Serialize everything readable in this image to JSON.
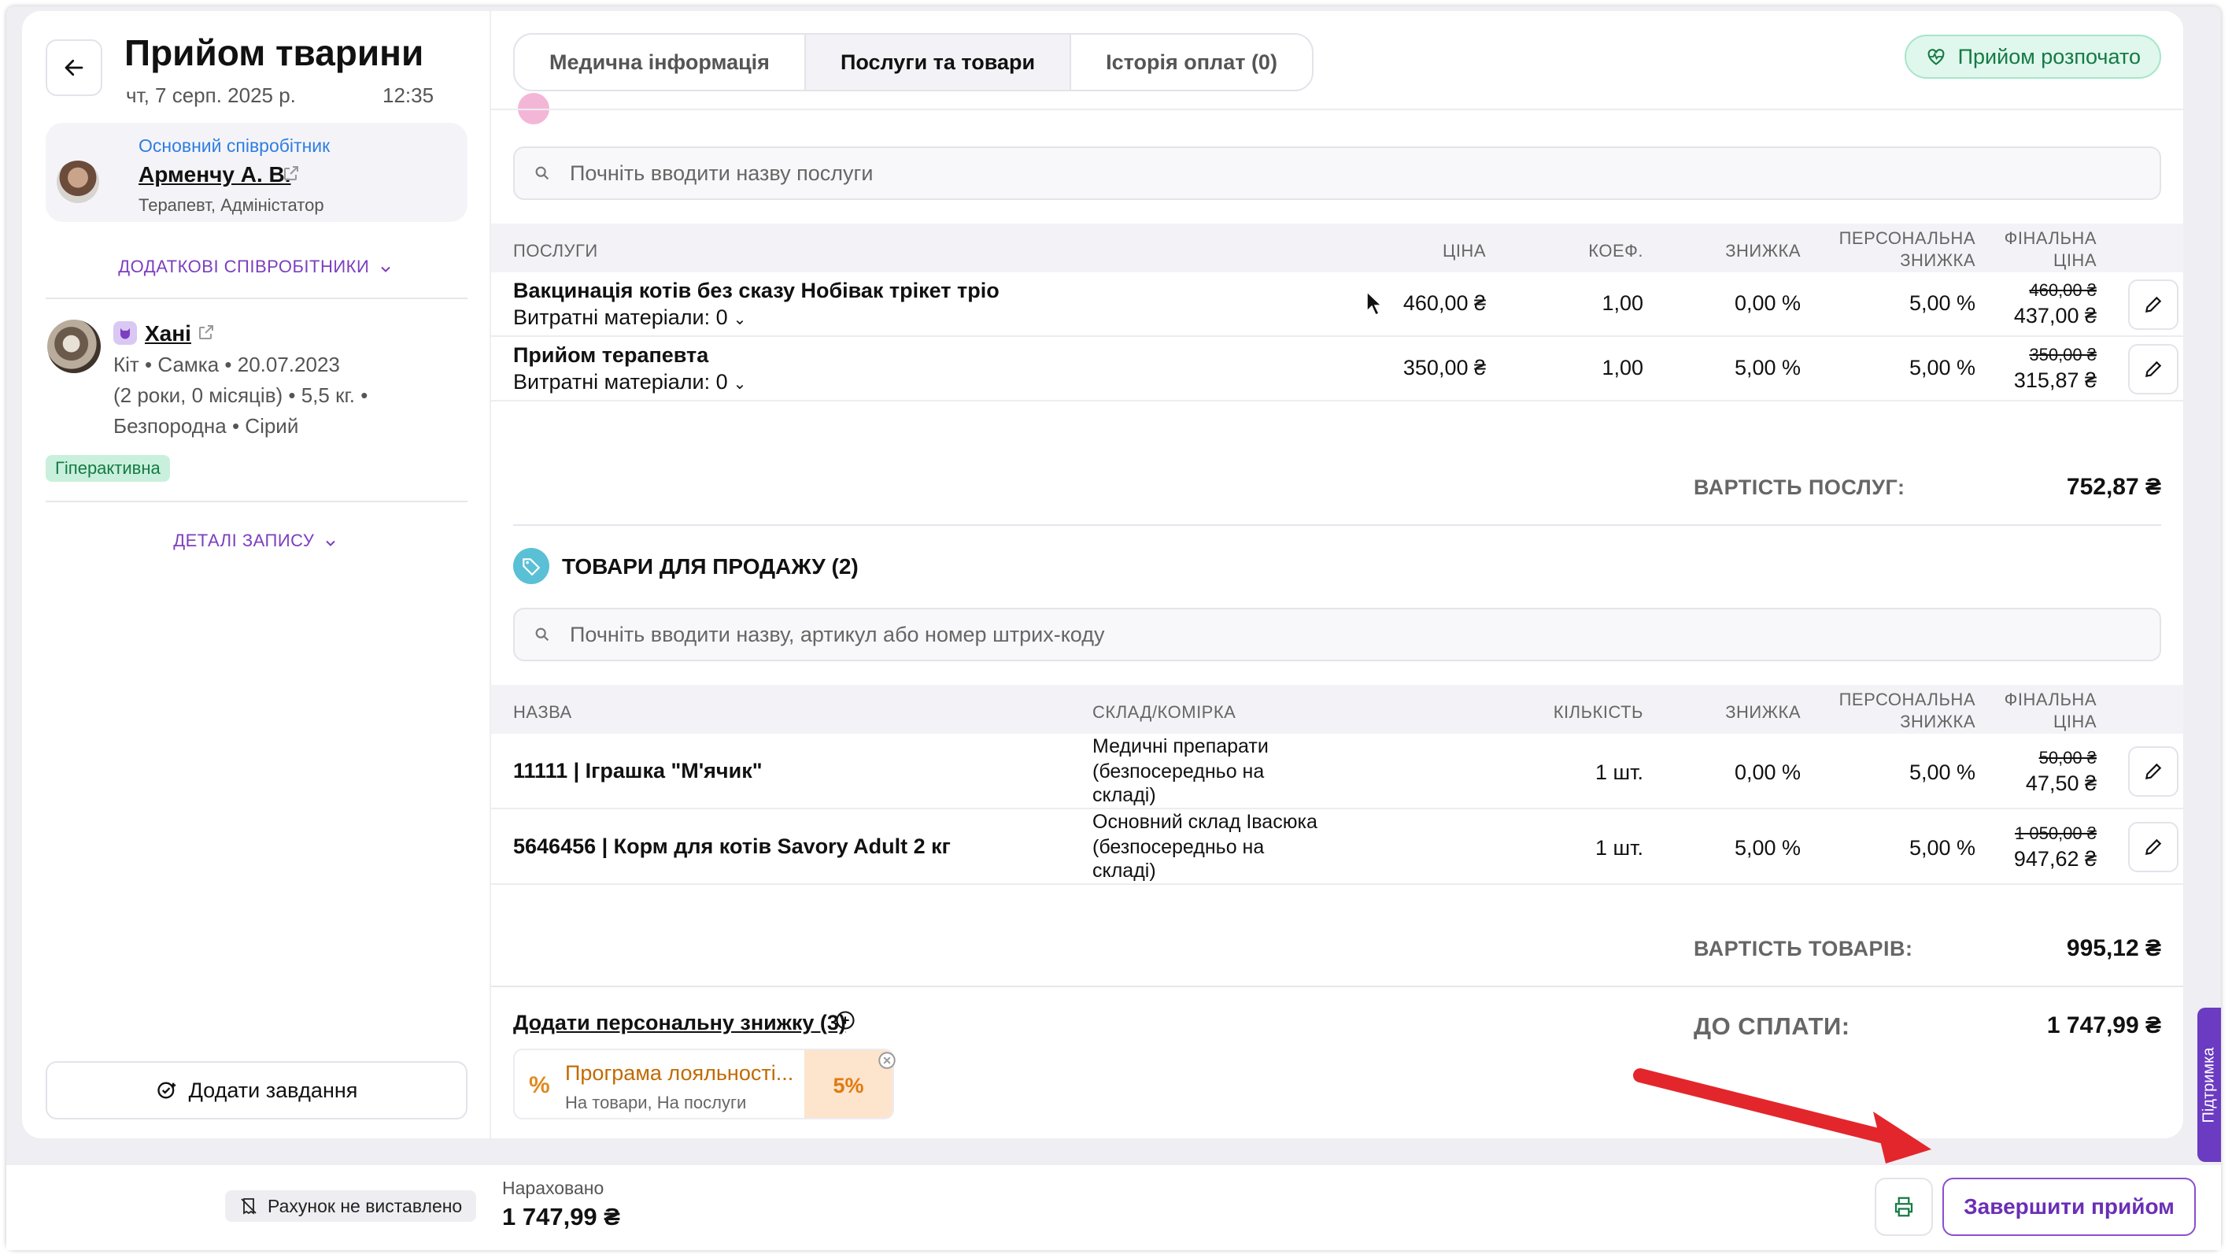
{
  "header": {
    "title": "Прийом тварини",
    "date": "чт, 7 серп. 2025 р.",
    "time": "12:35"
  },
  "staff": {
    "role_label": "Основний співробітник",
    "name": "Арменчу А. В.",
    "position": "Терапевт, Адміністатор",
    "extra_link": "ДОДАТКОВІ СПІВРОБІТНИКИ"
  },
  "pet": {
    "name": "Хані",
    "line1": "Кіт • Самка • 20.07.2023",
    "line2": "(2 роки, 0 місяців) • 5,5 кг. •",
    "line3": "Безпородна • Сірий",
    "tag": "Гіперактивна",
    "details_link": "ДЕТАЛІ ЗАПИСУ"
  },
  "left_actions": {
    "add_task": "Додати завдання"
  },
  "tabs": [
    {
      "label": "Медична інформація"
    },
    {
      "label": "Послуги та товари"
    },
    {
      "label": "Історія оплат (0)"
    }
  ],
  "status": {
    "label": "Прийом розпочато"
  },
  "services": {
    "search_placeholder": "Почніть вводити назву послуги",
    "headers": {
      "name": "ПОСЛУГИ",
      "price": "ЦІНА",
      "coef": "КОЕФ.",
      "discount": "ЗНИЖКА",
      "personal1": "ПЕРСОНАЛЬНА",
      "personal2": "ЗНИЖКА",
      "final1": "ФІНАЛЬНА",
      "final2": "ЦІНА"
    },
    "rows": [
      {
        "name": "Вакцинація котів без сказу Нобівак трікет тріо",
        "materials": "Витратні матеріали: 0",
        "price": "460,00 ₴",
        "coef": "1,00",
        "discount": "0,00 %",
        "personal": "5,00 %",
        "old": "460,00 ₴",
        "final": "437,00 ₴"
      },
      {
        "name": "Прийом терапевта",
        "materials": "Витратні матеріали: 0",
        "price": "350,00 ₴",
        "coef": "1,00",
        "discount": "5,00 %",
        "personal": "5,00 %",
        "old": "350,00 ₴",
        "final": "315,87 ₴"
      }
    ],
    "total_label": "ВАРТІСТЬ ПОСЛУГ:",
    "total_value": "752,87 ₴"
  },
  "goods": {
    "section_title": "ТОВАРИ ДЛЯ ПРОДАЖУ (2)",
    "search_placeholder": "Почніть вводити назву, артикул або номер штрих-коду",
    "headers": {
      "name": "НАЗВА",
      "storage": "СКЛАД/КОМІРКА",
      "qty": "КІЛЬКІСТЬ",
      "discount": "ЗНИЖКА",
      "personal1": "ПЕРСОНАЛЬНА",
      "personal2": "ЗНИЖКА",
      "final1": "ФІНАЛЬНА",
      "final2": "ЦІНА"
    },
    "rows": [
      {
        "name": "11111 | Іграшка \"М'ячик\"",
        "storage1": "Медичні препарати",
        "storage2": "(безпосередньо на",
        "storage3": "складі)",
        "qty": "1 шт.",
        "discount": "0,00 %",
        "personal": "5,00 %",
        "old": "50,00 ₴",
        "final": "47,50 ₴"
      },
      {
        "name": "5646456 | Корм для котів Savory Adult 2 кг",
        "storage1": "Основний склад Івасюка",
        "storage2": "(безпосередньо на",
        "storage3": "складі)",
        "qty": "1 шт.",
        "discount": "5,00 %",
        "personal": "5,00 %",
        "old": "1 050,00 ₴",
        "final": "947,62 ₴"
      }
    ],
    "total_label": "ВАРТІСТЬ ТОВАРІВ:",
    "total_value": "995,12 ₴"
  },
  "discounts": {
    "add_link": "Додати персональну знижку (3)",
    "loyalty_title": "Програма лояльності...",
    "loyalty_sub": "На товари, На послуги",
    "loyalty_value": "5%"
  },
  "payable": {
    "label": "ДО СПЛАТИ:",
    "value": "1 747,99 ₴"
  },
  "footer": {
    "invoice_status": "Рахунок не виставлено",
    "accrued_label": "Нараховано",
    "accrued_value": "1 747,99 ₴",
    "finish_button": "Завершити прийом",
    "support_label": "Підтримка"
  },
  "colors": {
    "accent": "#7b3fbf",
    "success": "#157a45",
    "warning": "#c48a00",
    "annotation_arrow": "#e3262b"
  }
}
